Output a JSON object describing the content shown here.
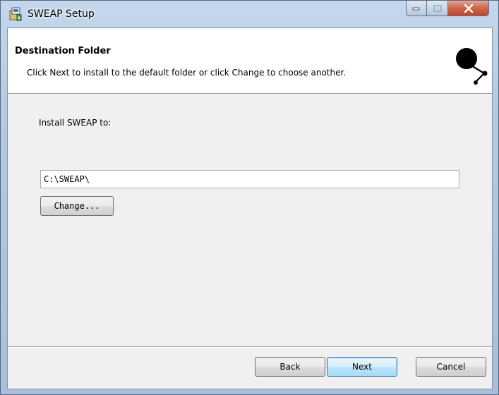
{
  "window": {
    "title": "SWEAP Setup"
  },
  "banner": {
    "title": "Destination Folder",
    "description": "Click Next to install to the default folder or click Change to choose another."
  },
  "form": {
    "install_label": "Install SWEAP to:",
    "path_value": "C:\\SWEAP\\",
    "change_label": "Change..."
  },
  "buttons": {
    "back": "Back",
    "next": "Next",
    "cancel": "Cancel"
  },
  "colors": {
    "titlebar": "#b4c9e2",
    "close_button": "#c1452c",
    "default_button_border": "#3c7fb1"
  }
}
